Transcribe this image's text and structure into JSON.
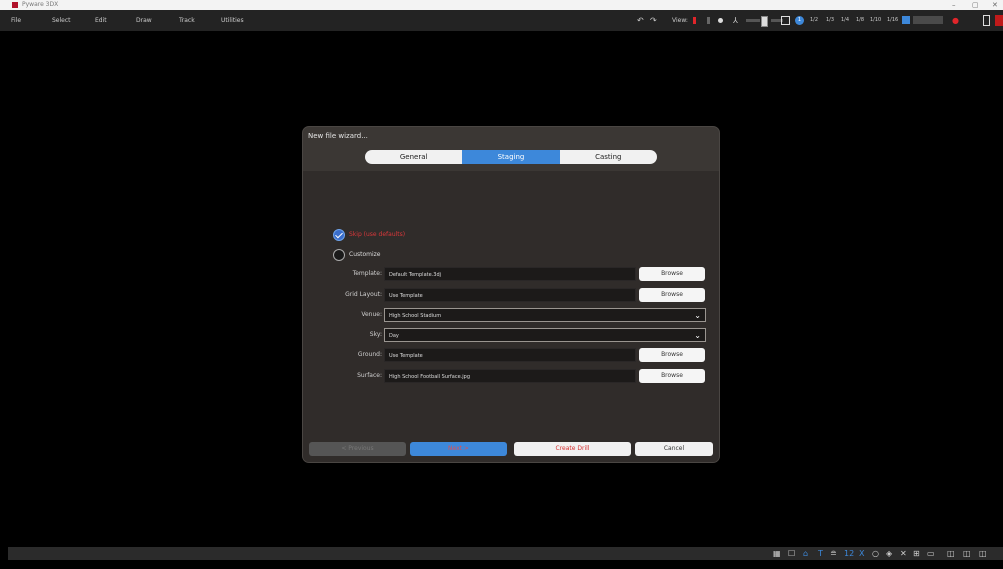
{
  "window": {
    "title": "Pyware 3DX",
    "minimize": "–",
    "maximize": "▢",
    "close": "✕"
  },
  "menu": [
    "File",
    "Select",
    "Edit",
    "Draw",
    "Track",
    "Utilities"
  ],
  "toolbar": {
    "view_label": "View:",
    "fractions": [
      "1/2",
      "1/3",
      "1/4",
      "1/8",
      "1/10",
      "1/16"
    ],
    "level_value": "1"
  },
  "statusbar": {
    "zoom_value": "12",
    "zoom_x": "X"
  },
  "dialog": {
    "title": "New file wizard...",
    "tabs": [
      {
        "label": "General"
      },
      {
        "label": "Staging"
      },
      {
        "label": "Casting"
      }
    ],
    "options": {
      "skip": "Skip (use defaults)",
      "customize": "Customize"
    },
    "fields": {
      "template": {
        "label": "Template:",
        "value": "Default Template.3dj"
      },
      "grid": {
        "label": "Grid Layout:",
        "value": "Use Template"
      },
      "venue": {
        "label": "Venue:",
        "value": "High School Stadium"
      },
      "sky": {
        "label": "Sky:",
        "value": "Day"
      },
      "ground": {
        "label": "Ground:",
        "value": "Use Template"
      },
      "surface": {
        "label": "Surface:",
        "value": "High School Football Surface.jpg"
      }
    },
    "browse_label": "Browse",
    "buttons": {
      "previous": "< Previous",
      "next": "Next >",
      "create": "Create Drill",
      "cancel": "Cancel"
    }
  },
  "colors": {
    "accent": "#3d88da",
    "danger": "#d8373a",
    "dialog_bg": "#3b3734",
    "panel_bg": "#302c2a"
  }
}
